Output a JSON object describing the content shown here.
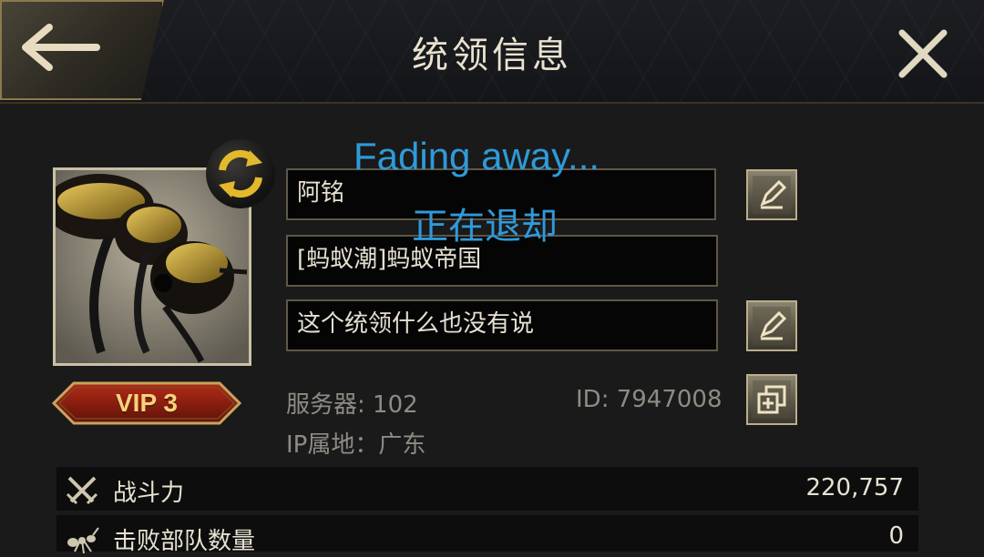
{
  "header": {
    "title": "统领信息",
    "back_icon": "arrow-left-icon",
    "close_icon": "close-icon"
  },
  "profile": {
    "avatar": "ant-avatar",
    "vip_label": "VIP 3",
    "name": "阿铭",
    "alliance": "[蚂蚁潮]蚂蚁帝国",
    "motto": "这个统领什么也没有说",
    "server": "服务器: 102",
    "player_id": "ID: 7947008",
    "ip_location": "IP属地：广东"
  },
  "overlay": {
    "english": "Fading away...",
    "chinese": "正在退却"
  },
  "stats": [
    {
      "label": "战斗力",
      "value": "220,757",
      "icon": "crossed-swords-icon"
    },
    {
      "label": "击败部队数量",
      "value": "0",
      "icon": "ant-icon"
    }
  ],
  "colors": {
    "accent_gold": "#c9b27a",
    "overlay_blue": "#2f9ad9",
    "vip_red": "#8e1d10"
  }
}
